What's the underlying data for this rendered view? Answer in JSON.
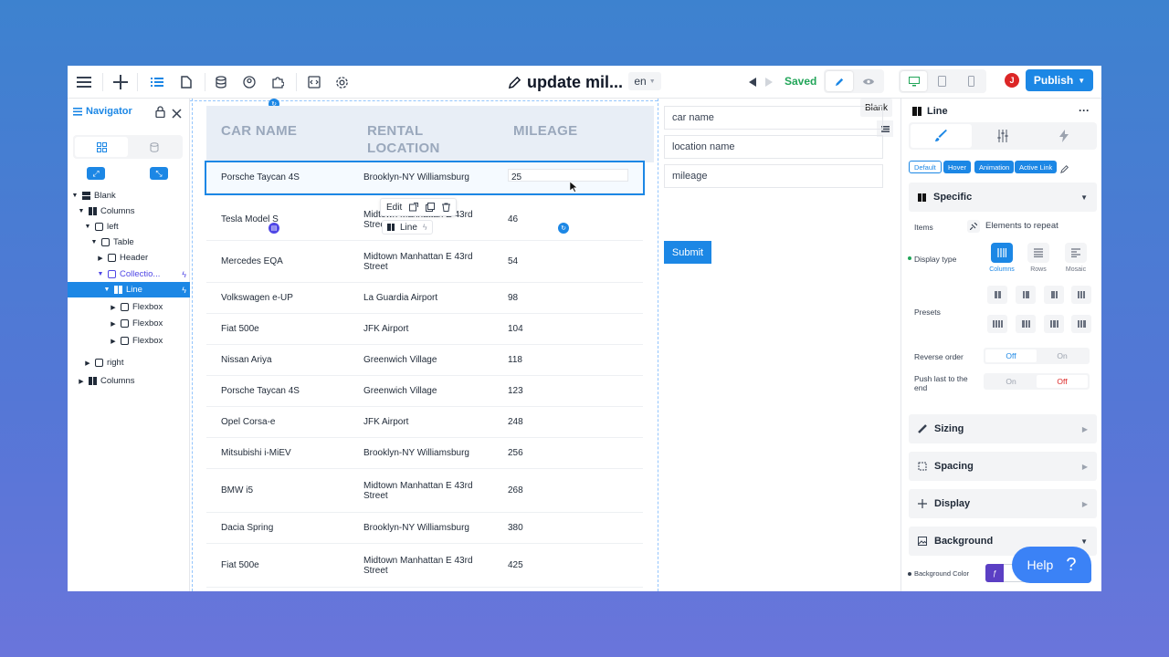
{
  "topbar": {
    "title": "update mil...",
    "lang": "en",
    "saved": "Saved",
    "publish": "Publish",
    "avatar_initial": "J"
  },
  "navigator": {
    "title": "Navigator",
    "tree": [
      {
        "label": "Blank",
        "depth": 0,
        "caret": "▼",
        "icon": "blank"
      },
      {
        "label": "Columns",
        "depth": 1,
        "caret": "▼",
        "icon": "columns"
      },
      {
        "label": "left",
        "depth": 2,
        "caret": "▼",
        "icon": "box"
      },
      {
        "label": "Table",
        "depth": 3,
        "caret": "▼",
        "icon": "box"
      },
      {
        "label": "Header",
        "depth": 4,
        "caret": "▶",
        "icon": "box"
      },
      {
        "label": "Collectio...",
        "depth": 4,
        "caret": "▼",
        "icon": "box"
      },
      {
        "label": "Line",
        "depth": 5,
        "caret": "▼",
        "icon": "columns"
      },
      {
        "label": "Flexbox",
        "depth": 6,
        "caret": "▶",
        "icon": "box"
      },
      {
        "label": "Flexbox",
        "depth": 6,
        "caret": "▶",
        "icon": "box"
      },
      {
        "label": "Flexbox",
        "depth": 6,
        "caret": "▶",
        "icon": "box"
      },
      {
        "label": "right",
        "depth": 2,
        "caret": "▶",
        "icon": "box"
      },
      {
        "label": "Columns",
        "depth": 1,
        "caret": "▶",
        "icon": "columns"
      }
    ]
  },
  "table": {
    "headers": [
      "CAR NAME",
      "RENTAL LOCATION",
      "MILEAGE"
    ],
    "rows": [
      {
        "car": "Porsche Taycan 4S",
        "location": "Brooklyn-NY Williamsburg",
        "mileage": "25"
      },
      {
        "car": "Tesla Model S",
        "location": "Midtown Manhattan E 43rd Street",
        "mileage": "46"
      },
      {
        "car": "Mercedes EQA",
        "location": "Midtown Manhattan E 43rd Street",
        "mileage": "54"
      },
      {
        "car": "Volkswagen e-UP",
        "location": "La Guardia Airport",
        "mileage": "98"
      },
      {
        "car": "Fiat 500e",
        "location": "JFK Airport",
        "mileage": "104"
      },
      {
        "car": "Nissan Ariya",
        "location": "Greenwich Village",
        "mileage": "118"
      },
      {
        "car": "Porsche Taycan 4S",
        "location": "Greenwich Village",
        "mileage": "123"
      },
      {
        "car": "Opel Corsa-e",
        "location": "JFK Airport",
        "mileage": "248"
      },
      {
        "car": "Mitsubishi i-MiEV",
        "location": "Brooklyn-NY Williamsburg",
        "mileage": "256"
      },
      {
        "car": "BMW i5",
        "location": "Midtown Manhattan E 43rd Street",
        "mileage": "268"
      },
      {
        "car": "Dacia Spring",
        "location": "Brooklyn-NY Williamsburg",
        "mileage": "380"
      },
      {
        "car": "Fiat 500e",
        "location": "Midtown Manhattan E 43rd Street",
        "mileage": "425"
      }
    ]
  },
  "float": {
    "edit": "Edit",
    "line_tag": "Line"
  },
  "form": {
    "car_placeholder": "car name",
    "location_placeholder": "location name",
    "mileage_placeholder": "mileage",
    "submit": "Submit",
    "blank_tag": "Blank"
  },
  "panel": {
    "title": "Line",
    "states": [
      "Default",
      "Hover",
      "Animation",
      "Active Link"
    ],
    "specific": "Specific",
    "items_label": "Items",
    "items_value": "Elements to repeat",
    "display_type_label": "Display type",
    "display_types": [
      "Columns",
      "Rows",
      "Mosaic"
    ],
    "presets_label": "Presets",
    "reverse_label": "Reverse order",
    "push_label": "Push last to the end",
    "reverse_options": [
      "Off",
      "On"
    ],
    "push_options": [
      "On",
      "Off"
    ],
    "sections": [
      "Sizing",
      "Spacing",
      "Display",
      "Background"
    ],
    "bg_color_label": "Background Color",
    "accent": "#1c87e5"
  },
  "help": {
    "label": "Help"
  }
}
